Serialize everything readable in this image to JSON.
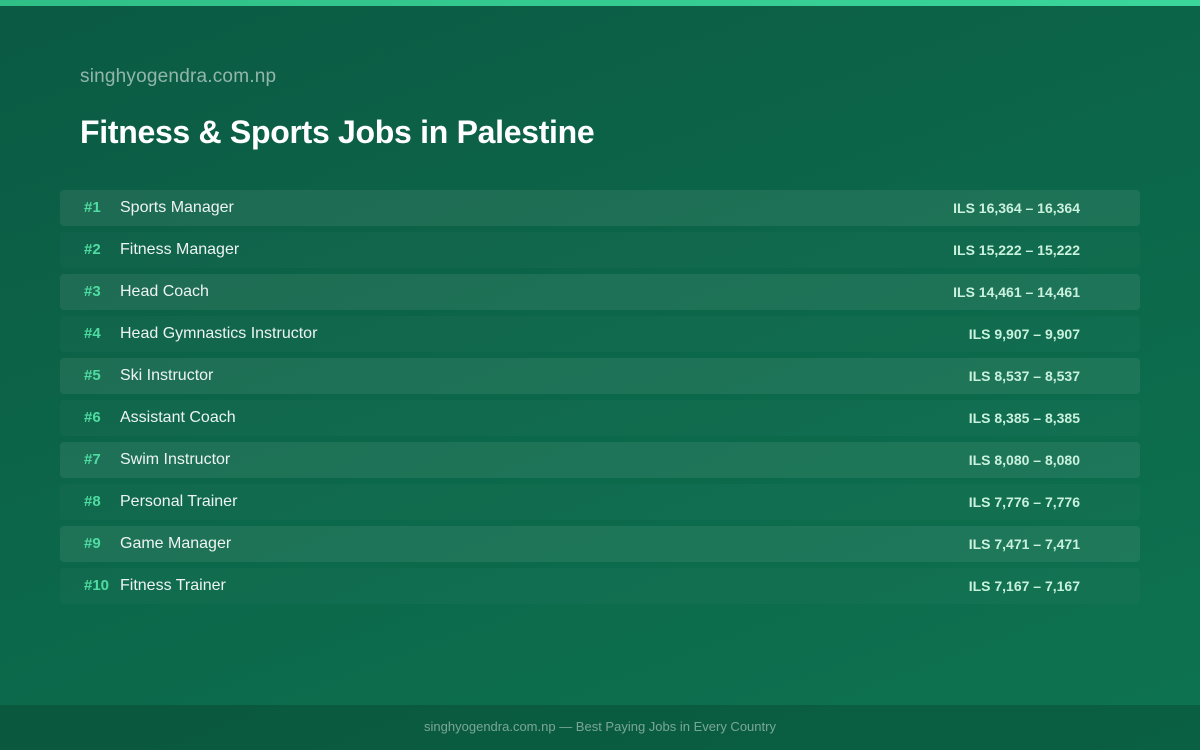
{
  "site_name": "singhyogendra.com.np",
  "page_title": "Fitness & Sports Jobs in Palestine",
  "jobs": [
    {
      "rank": "#1",
      "title": "Sports Manager",
      "salary": "ILS 16,364 – 16,364"
    },
    {
      "rank": "#2",
      "title": "Fitness Manager",
      "salary": "ILS 15,222 – 15,222"
    },
    {
      "rank": "#3",
      "title": "Head Coach",
      "salary": "ILS 14,461 – 14,461"
    },
    {
      "rank": "#4",
      "title": "Head Gymnastics Instructor",
      "salary": "ILS 9,907 – 9,907"
    },
    {
      "rank": "#5",
      "title": "Ski Instructor",
      "salary": "ILS 8,537 – 8,537"
    },
    {
      "rank": "#6",
      "title": "Assistant Coach",
      "salary": "ILS 8,385 – 8,385"
    },
    {
      "rank": "#7",
      "title": "Swim Instructor",
      "salary": "ILS 8,080 – 8,080"
    },
    {
      "rank": "#8",
      "title": "Personal Trainer",
      "salary": "ILS 7,776 – 7,776"
    },
    {
      "rank": "#9",
      "title": "Game Manager",
      "salary": "ILS 7,471 – 7,471"
    },
    {
      "rank": "#10",
      "title": "Fitness Trainer",
      "salary": "ILS 7,167 – 7,167"
    }
  ],
  "footer_text": "singhyogendra.com.np — Best Paying Jobs in Every Country",
  "colors": {
    "background": "#0c6649",
    "accent": "#4fdca2",
    "salary_text": "#c9f1de"
  }
}
